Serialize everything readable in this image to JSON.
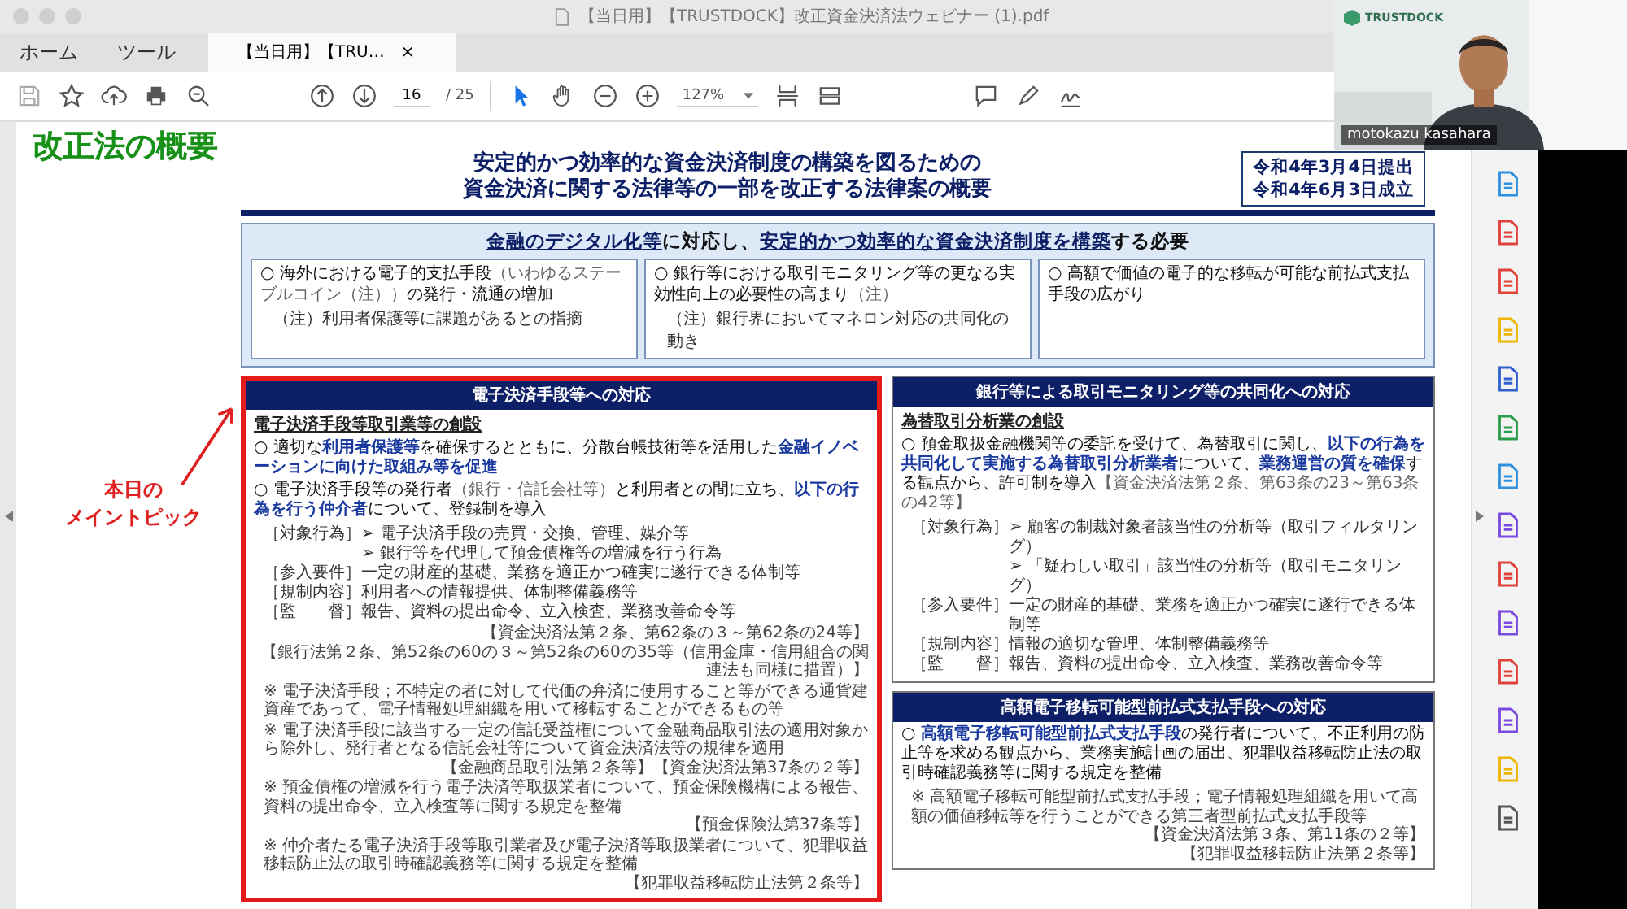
{
  "window": {
    "title": "【当日用】【TRUSTDOCK】改正資金決済法ウェビナー (1).pdf"
  },
  "nav_tabs": [
    {
      "label": "ホーム",
      "selected": false
    },
    {
      "label": "ツール",
      "selected": false
    },
    {
      "label": "【当日用】【TRU…",
      "selected": true,
      "close": "×"
    }
  ],
  "toolbar": {
    "page": "16",
    "page_total": "/ 25",
    "zoom": "127%"
  },
  "slide": {
    "heading": "改正法の概要",
    "title": [
      "安定的かつ効率的な資金決済制度の構築を図るための",
      "資金決済に関する法律等の一部を改正する法律案の概要"
    ],
    "dates": [
      "令和4年3月4日提出",
      "令和4年6月3日成立"
    ],
    "need": [
      {
        "text": "金融のデジタル化等",
        "kind": "underline"
      },
      {
        "text": "に対応し、",
        "kind": "plain"
      },
      {
        "text": "安定的かつ効率的な資金決済制度を構築",
        "kind": "underline"
      },
      {
        "text": "する必要",
        "kind": "plain"
      }
    ],
    "cards": [
      {
        "parts": [
          {
            "text": "○ 海外における電子的支払手段",
            "kind": "plain"
          },
          {
            "text": "（いわゆるステーブルコイン（注））",
            "kind": "small"
          },
          {
            "text": "の発行・流通の増加",
            "kind": "plain"
          }
        ],
        "note": "（注）利用者保護等に課題があるとの指摘"
      },
      {
        "parts": [
          {
            "text": "○ 銀行等における取引モニタリング等の更なる実効性向上の必要性の高まり",
            "kind": "plain"
          },
          {
            "text": "（注）",
            "kind": "small"
          }
        ],
        "note": "（注）銀行界においてマネロン対応の共同化の動き"
      },
      {
        "parts": [
          {
            "text": "○ 高額で価値の電子的な移転が可能な前払式支払手段の広がり",
            "kind": "plain"
          }
        ]
      }
    ],
    "columns": [
      [
        {
          "header": "電子決済手段等への対応",
          "highlighted": true,
          "subtitle": "電子決済手段等取引業等の創設",
          "bullets": [
            [
              {
                "text": "○ 適切な",
                "kind": "plain"
              },
              {
                "text": "利用者保護等",
                "kind": "em"
              },
              {
                "text": "を確保するとともに、分散台帳技術等を活用した",
                "kind": "plain"
              },
              {
                "text": "金融イノベーションに向けた取組み等を促進",
                "kind": "em"
              }
            ],
            [
              {
                "text": "○ 電子決済手段等の発行者",
                "kind": "plain"
              },
              {
                "text": "（銀行・信託会社等）",
                "kind": "small"
              },
              {
                "text": "と利用者との間に立ち、",
                "kind": "plain"
              },
              {
                "text": "以下の行為を行う仲介者",
                "kind": "em"
              },
              {
                "text": "について、登録制を導入",
                "kind": "plain"
              }
            ]
          ],
          "rows": [
            {
              "label": "［対象行為］",
              "items": [
                "➢ 電子決済手段の売買・交換、管理、媒介等",
                "➢ 銀行等を代理して預金債権等の増減を行う行為"
              ]
            },
            {
              "label": "［参入要件］",
              "items": [
                "一定の財産的基礎、業務を適正かつ確実に遂行できる体制等"
              ]
            },
            {
              "label": "［規制内容］",
              "items": [
                "利用者への情報提供、体制整備義務等"
              ]
            },
            {
              "label": "［監　　督］",
              "items": [
                "報告、資料の提出命令、立入検査、業務改善命令等"
              ]
            }
          ],
          "refs": [
            "【資金決済法第２条、第62条の３～第62条の24等】",
            "【銀行法第２条、第52条の60の３～第52条の60の35等（信用金庫・信用組合の関連法も同様に措置）】"
          ],
          "notes": [
            {
              "text": "※ 電子決済手段；不特定の者に対して代価の弁済に使用すること等ができる通貨建資産であって、電子情報処理組織を用いて移転することができるもの等"
            },
            {
              "text": "※ 電子決済手段に該当する一定の信託受益権について金融商品取引法の適用対象から除外し、発行者となる信託会社等について資金決済法等の規律を適用",
              "refs": [
                "【金融商品取引法第２条等】【資金決済法第37条の２等】"
              ]
            },
            {
              "text": "※ 預金債権の増減を行う電子決済等取扱業者について、預金保険機構による報告、資料の提出命令、立入検査等に関する規定を整備",
              "refs": [
                "【預金保険法第37条等】"
              ]
            },
            {
              "text": "※ 仲介者たる電子決済手段等取引業者及び電子決済等取扱業者について、犯罪収益移転防止法の取引時確認義務等に関する規定を整備",
              "refs": [
                "【犯罪収益移転防止法第２条等】"
              ]
            }
          ]
        }
      ],
      [
        {
          "header": "銀行等による取引モニタリング等の共同化への対応",
          "highlighted": false,
          "subtitle": "為替取引分析業の創設",
          "bullets": [
            [
              {
                "text": "○ 預金取扱金融機関等の委託を受けて、為替取引に関し、",
                "kind": "plain"
              },
              {
                "text": "以下の行為を共同化して実施する為替取引分析業者",
                "kind": "em"
              },
              {
                "text": "について、",
                "kind": "plain"
              },
              {
                "text": "業務運営の質を確保",
                "kind": "em"
              },
              {
                "text": "する観点から、許可制を導入",
                "kind": "plain"
              },
              {
                "text": "【資金決済法第２条、第63条の23～第63条の42等】",
                "kind": "small"
              }
            ]
          ],
          "rows": [
            {
              "label": "［対象行為］",
              "items": [
                "➢ 顧客の制裁対象者該当性の分析等（取引フィルタリング）",
                "➢ 「疑わしい取引」該当性の分析等（取引モニタリング）"
              ]
            },
            {
              "label": "［参入要件］",
              "items": [
                "一定の財産的基礎、業務を適正かつ確実に遂行できる体制等"
              ]
            },
            {
              "label": "［規制内容］",
              "items": [
                "情報の適切な管理、体制整備義務等"
              ]
            },
            {
              "label": "［監　　督］",
              "items": [
                "報告、資料の提出命令、立入検査、業務改善命令等"
              ]
            }
          ]
        },
        {
          "header": "高額電子移転可能型前払式支払手段への対応",
          "highlighted": false,
          "bullets": [
            [
              {
                "text": "○ ",
                "kind": "plain"
              },
              {
                "text": "高額電子移転可能型前払式支払手段",
                "kind": "em"
              },
              {
                "text": "の発行者について、不正利用の防止等を求める観点から、業務実施計画の届出、犯罪収益移転防止法の取引時確認義務等に関する規定を整備",
                "kind": "plain"
              }
            ]
          ],
          "notes": [
            {
              "text": "※ 高額電子移転可能型前払式支払手段；電子情報処理組織を用いて高額の価値移転等を行うことができる第三者型前払式支払手段等",
              "refs": [
                "【資金決済法第３条、第11条の２等】",
                "【犯罪収益移転防止法第２条等】"
              ]
            }
          ]
        }
      ]
    ]
  },
  "annotation": [
    "本日の",
    "メイントピック"
  ],
  "webcam": {
    "logo": "TRUSTDOCK",
    "name": "motokazu kasahara"
  }
}
